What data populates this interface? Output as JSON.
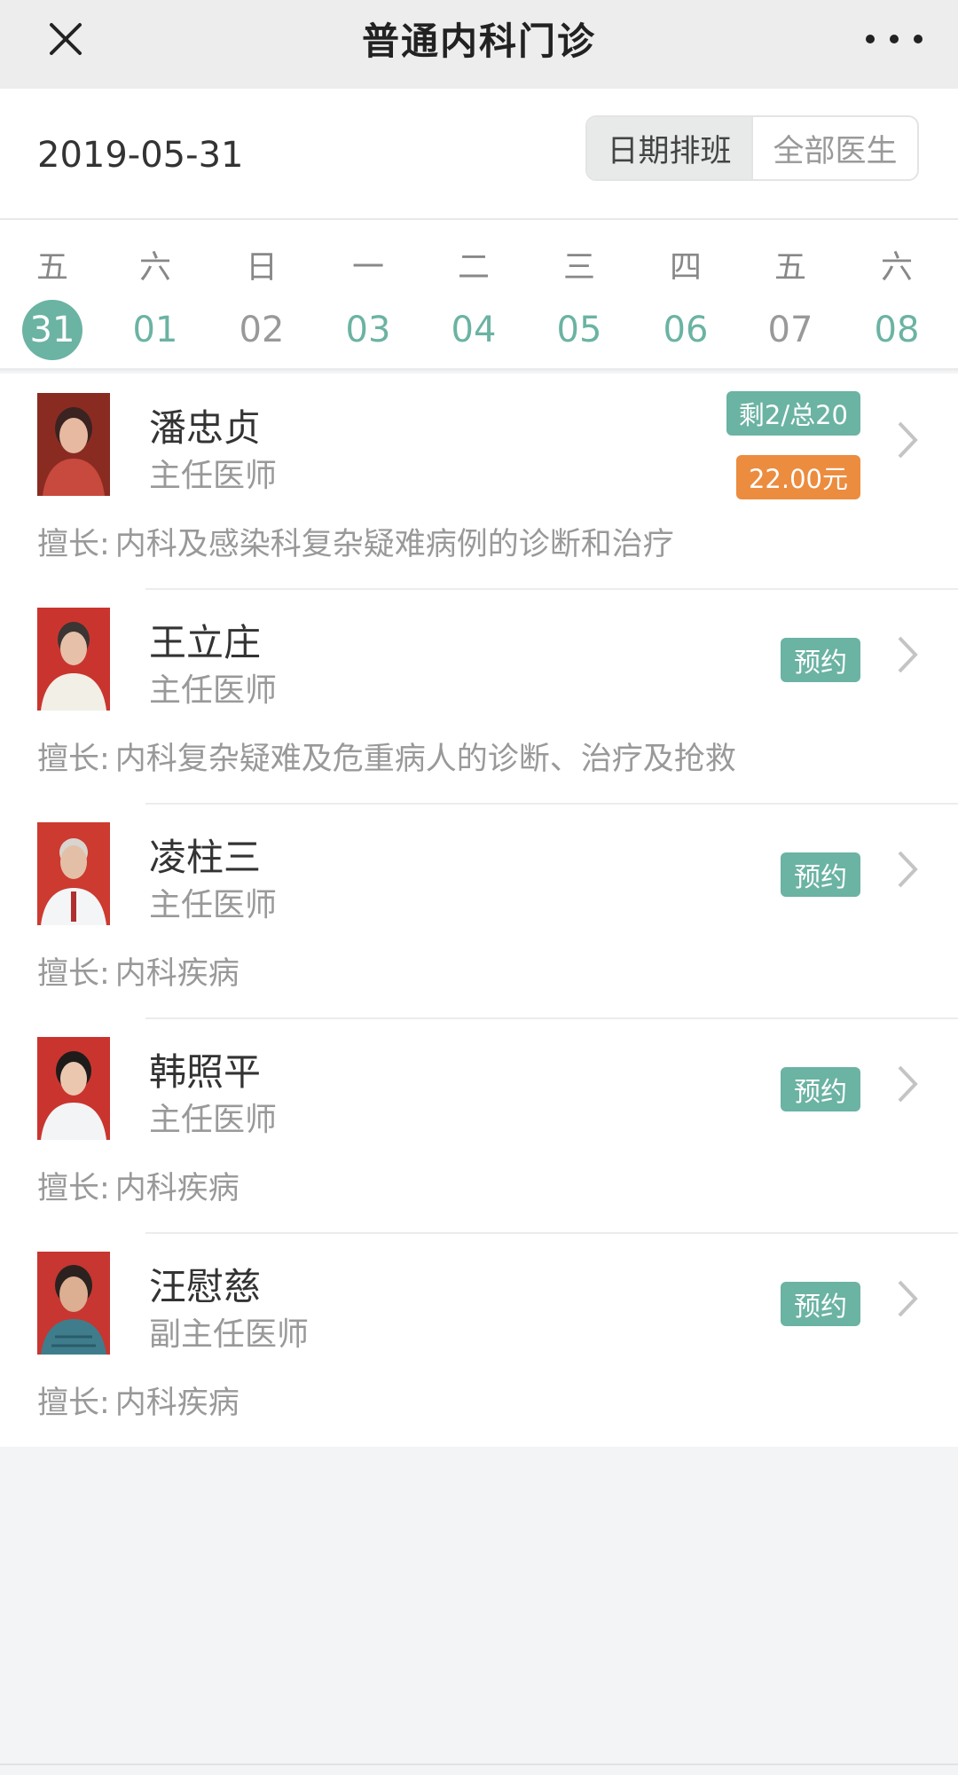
{
  "nav": {
    "title": "普通内科门诊",
    "close_icon": "close-icon",
    "more_icon": "more-icon"
  },
  "header": {
    "date": "2019-05-31",
    "tabs": [
      {
        "label": "日期排班",
        "active": true
      },
      {
        "label": "全部医生",
        "active": false
      }
    ]
  },
  "week": [
    {
      "weekday": "五",
      "day": "31",
      "state": "selected"
    },
    {
      "weekday": "六",
      "day": "01",
      "state": "available"
    },
    {
      "weekday": "日",
      "day": "02",
      "state": "unavailable"
    },
    {
      "weekday": "一",
      "day": "03",
      "state": "available"
    },
    {
      "weekday": "二",
      "day": "04",
      "state": "available"
    },
    {
      "weekday": "三",
      "day": "05",
      "state": "available"
    },
    {
      "weekday": "四",
      "day": "06",
      "state": "available"
    },
    {
      "weekday": "五",
      "day": "07",
      "state": "unavailable"
    },
    {
      "weekday": "六",
      "day": "08",
      "state": "available"
    }
  ],
  "colors": {
    "accent": "#6bb3a3",
    "price": "#ec8c3f"
  },
  "specialty_label": "擅长:",
  "doctors": [
    {
      "name": "潘忠贞",
      "title": "主任医师",
      "specialty": "内科及感染科复杂疑难病例的诊断和治疗",
      "remaining": "剩2/总20",
      "price": "22.00元",
      "action": ""
    },
    {
      "name": "王立庄",
      "title": "主任医师",
      "specialty": "内科复杂疑难及危重病人的诊断、治疗及抢救",
      "remaining": "",
      "price": "",
      "action": "预约"
    },
    {
      "name": "凌柱三",
      "title": "主任医师",
      "specialty": "内科疾病",
      "remaining": "",
      "price": "",
      "action": "预约"
    },
    {
      "name": "韩照平",
      "title": "主任医师",
      "specialty": "内科疾病",
      "remaining": "",
      "price": "",
      "action": "预约"
    },
    {
      "name": "汪慰慈",
      "title": "副主任医师",
      "specialty": "内科疾病",
      "remaining": "",
      "price": "",
      "action": "预约"
    }
  ]
}
